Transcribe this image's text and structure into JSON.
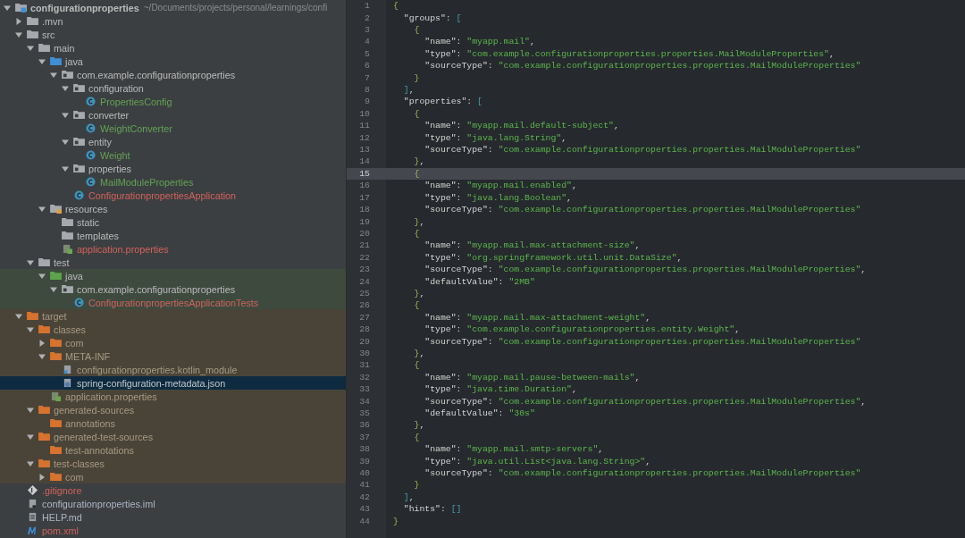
{
  "project_tree": {
    "items": [
      {
        "label": "configurationproperties",
        "path": "~/Documents/projects/personal/learnings/confi",
        "kind": "project",
        "expanded": true,
        "selected": false,
        "children": [
          {
            "label": ".mvn",
            "kind": "folder",
            "expanded": false,
            "selected": false
          },
          {
            "label": "src",
            "kind": "folder",
            "expanded": true,
            "selected": false,
            "children": [
              {
                "label": "main",
                "kind": "folder",
                "expanded": true,
                "selected": false,
                "children": [
                  {
                    "label": "java",
                    "kind": "source-root",
                    "expanded": true,
                    "selected": false,
                    "children": [
                      {
                        "label": "com.example.configurationproperties",
                        "kind": "package",
                        "expanded": true,
                        "selected": false,
                        "children": [
                          {
                            "label": "configuration",
                            "kind": "package",
                            "expanded": true,
                            "selected": false,
                            "children": [
                              {
                                "label": "PropertiesConfig",
                                "kind": "class",
                                "color": "#62a255",
                                "selected": false
                              }
                            ]
                          },
                          {
                            "label": "converter",
                            "kind": "package",
                            "expanded": true,
                            "selected": false,
                            "children": [
                              {
                                "label": "WeightConverter",
                                "kind": "class",
                                "color": "#62a255",
                                "selected": false
                              }
                            ]
                          },
                          {
                            "label": "entity",
                            "kind": "package",
                            "expanded": true,
                            "selected": false,
                            "children": [
                              {
                                "label": "Weight",
                                "kind": "class",
                                "color": "#62a255",
                                "selected": false
                              }
                            ]
                          },
                          {
                            "label": "properties",
                            "kind": "package",
                            "expanded": true,
                            "selected": false,
                            "children": [
                              {
                                "label": "MailModuleProperties",
                                "kind": "class",
                                "color": "#62a255",
                                "selected": false
                              }
                            ]
                          },
                          {
                            "label": "ConfigurationpropertiesApplication",
                            "kind": "spring-class",
                            "color": "#d1625c",
                            "selected": false
                          }
                        ]
                      }
                    ]
                  },
                  {
                    "label": "resources",
                    "kind": "resources-root",
                    "expanded": true,
                    "selected": false,
                    "children": [
                      {
                        "label": "static",
                        "kind": "folder",
                        "selected": false
                      },
                      {
                        "label": "templates",
                        "kind": "folder",
                        "selected": false
                      },
                      {
                        "label": "application.properties",
                        "kind": "properties-file",
                        "color": "#d1625c",
                        "selected": false
                      }
                    ]
                  }
                ]
              },
              {
                "label": "test",
                "kind": "folder",
                "expanded": true,
                "selected": false,
                "children": [
                  {
                    "label": "java",
                    "kind": "test-root",
                    "test_source": true,
                    "expanded": true,
                    "selected": false,
                    "children": [
                      {
                        "label": "com.example.configurationproperties",
                        "kind": "package",
                        "expanded": true,
                        "selected": false,
                        "children": [
                          {
                            "label": "ConfigurationpropertiesApplicationTests",
                            "kind": "test-class",
                            "color": "#d1625c",
                            "selected": false
                          }
                        ]
                      }
                    ]
                  }
                ]
              }
            ]
          },
          {
            "label": "target",
            "kind": "folder",
            "excluded": true,
            "expanded": true,
            "selected": false,
            "children": [
              {
                "label": "classes",
                "kind": "folder",
                "expanded": true,
                "selected": false,
                "children": [
                  {
                    "label": "com",
                    "kind": "folder",
                    "expanded": false,
                    "selected": false
                  },
                  {
                    "label": "META-INF",
                    "kind": "folder",
                    "expanded": true,
                    "selected": false,
                    "children": [
                      {
                        "label": "configurationproperties.kotlin_module",
                        "kind": "module-file",
                        "color": "#a89a83",
                        "selected": false
                      },
                      {
                        "label": "spring-configuration-metadata.json",
                        "kind": "json-file",
                        "selected": true
                      }
                    ]
                  },
                  {
                    "label": "application.properties",
                    "kind": "properties-file",
                    "color": "#a89a83",
                    "selected": false
                  }
                ]
              },
              {
                "label": "generated-sources",
                "kind": "folder",
                "expanded": true,
                "selected": false,
                "children": [
                  {
                    "label": "annotations",
                    "kind": "folder",
                    "selected": false
                  }
                ]
              },
              {
                "label": "generated-test-sources",
                "kind": "folder",
                "expanded": true,
                "selected": false,
                "children": [
                  {
                    "label": "test-annotations",
                    "kind": "folder",
                    "selected": false
                  }
                ]
              },
              {
                "label": "test-classes",
                "kind": "folder",
                "expanded": true,
                "selected": false,
                "children": [
                  {
                    "label": "com",
                    "kind": "folder",
                    "expanded": false,
                    "selected": false
                  }
                ]
              }
            ]
          },
          {
            "label": ".gitignore",
            "kind": "gitignore",
            "color": "#d1625c",
            "selected": false
          },
          {
            "label": "configurationproperties.iml",
            "kind": "iml-file",
            "color": "#a9b7c6",
            "selected": false
          },
          {
            "label": "HELP.md",
            "kind": "md-file",
            "color": "#a9b7c6",
            "selected": false
          },
          {
            "label": "pom.xml",
            "kind": "maven-file",
            "color": "#d1625c",
            "selected": false
          }
        ]
      }
    ]
  },
  "editor": {
    "lines": [
      {
        "number": "1",
        "text": "{",
        "current": false
      },
      {
        "number": "2",
        "text": "  \"groups\": [",
        "current": false
      },
      {
        "number": "3",
        "text": "    {",
        "current": false
      },
      {
        "number": "4",
        "text": "      \"name\": \"myapp.mail\",",
        "current": false
      },
      {
        "number": "5",
        "text": "      \"type\": \"com.example.configurationproperties.properties.MailModuleProperties\",",
        "current": false
      },
      {
        "number": "6",
        "text": "      \"sourceType\": \"com.example.configurationproperties.properties.MailModuleProperties\"",
        "current": false
      },
      {
        "number": "7",
        "text": "    }",
        "current": false
      },
      {
        "number": "8",
        "text": "  ],",
        "current": false
      },
      {
        "number": "9",
        "text": "  \"properties\": [",
        "current": false
      },
      {
        "number": "10",
        "text": "    {",
        "current": false
      },
      {
        "number": "11",
        "text": "      \"name\": \"myapp.mail.default-subject\",",
        "current": false
      },
      {
        "number": "12",
        "text": "      \"type\": \"java.lang.String\",",
        "current": false
      },
      {
        "number": "13",
        "text": "      \"sourceType\": \"com.example.configurationproperties.properties.MailModuleProperties\"",
        "current": false
      },
      {
        "number": "14",
        "text": "    },",
        "current": false
      },
      {
        "number": "15",
        "text": "    {",
        "current": true
      },
      {
        "number": "16",
        "text": "      \"name\": \"myapp.mail.enabled\",",
        "current": false
      },
      {
        "number": "17",
        "text": "      \"type\": \"java.lang.Boolean\",",
        "current": false
      },
      {
        "number": "18",
        "text": "      \"sourceType\": \"com.example.configurationproperties.properties.MailModuleProperties\"",
        "current": false
      },
      {
        "number": "19",
        "text": "    },",
        "current": false
      },
      {
        "number": "20",
        "text": "    {",
        "current": false
      },
      {
        "number": "21",
        "text": "      \"name\": \"myapp.mail.max-attachment-size\",",
        "current": false
      },
      {
        "number": "22",
        "text": "      \"type\": \"org.springframework.util.unit.DataSize\",",
        "current": false
      },
      {
        "number": "23",
        "text": "      \"sourceType\": \"com.example.configurationproperties.properties.MailModuleProperties\",",
        "current": false
      },
      {
        "number": "24",
        "text": "      \"defaultValue\": \"2MB\"",
        "current": false
      },
      {
        "number": "25",
        "text": "    },",
        "current": false
      },
      {
        "number": "26",
        "text": "    {",
        "current": false
      },
      {
        "number": "27",
        "text": "      \"name\": \"myapp.mail.max-attachment-weight\",",
        "current": false
      },
      {
        "number": "28",
        "text": "      \"type\": \"com.example.configurationproperties.entity.Weight\",",
        "current": false
      },
      {
        "number": "29",
        "text": "      \"sourceType\": \"com.example.configurationproperties.properties.MailModuleProperties\"",
        "current": false
      },
      {
        "number": "30",
        "text": "    },",
        "current": false
      },
      {
        "number": "31",
        "text": "    {",
        "current": false
      },
      {
        "number": "32",
        "text": "      \"name\": \"myapp.mail.pause-between-mails\",",
        "current": false
      },
      {
        "number": "33",
        "text": "      \"type\": \"java.time.Duration\",",
        "current": false
      },
      {
        "number": "34",
        "text": "      \"sourceType\": \"com.example.configurationproperties.properties.MailModuleProperties\",",
        "current": false
      },
      {
        "number": "35",
        "text": "      \"defaultValue\": \"30s\"",
        "current": false
      },
      {
        "number": "36",
        "text": "    },",
        "current": false
      },
      {
        "number": "37",
        "text": "    {",
        "current": false
      },
      {
        "number": "38",
        "text": "      \"name\": \"myapp.mail.smtp-servers\",",
        "current": false
      },
      {
        "number": "39",
        "text": "      \"type\": \"java.util.List<java.lang.String>\",",
        "current": false
      },
      {
        "number": "40",
        "text": "      \"sourceType\": \"com.example.configurationproperties.properties.MailModuleProperties\"",
        "current": false
      },
      {
        "number": "41",
        "text": "    }",
        "current": false
      },
      {
        "number": "42",
        "text": "  ],",
        "current": false
      },
      {
        "number": "43",
        "text": "  \"hints\": []",
        "current": false
      },
      {
        "number": "44",
        "text": "}",
        "current": false
      }
    ]
  }
}
